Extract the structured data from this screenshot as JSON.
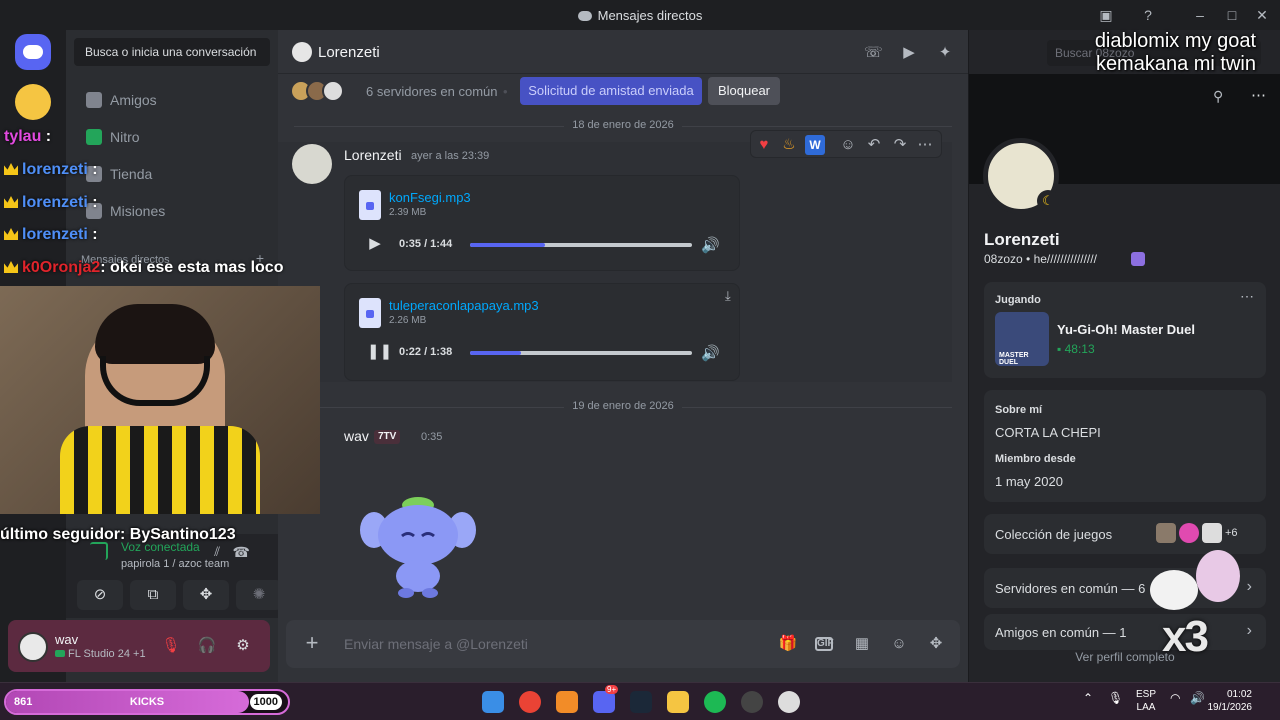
{
  "window": {
    "title": "Mensajes directos",
    "controls": [
      "inbox-icon",
      "help-icon",
      "minimize",
      "maximize",
      "close"
    ]
  },
  "sidebar": {
    "search_placeholder": "Busca o inicia una conversación",
    "nav": [
      {
        "label": "Amigos",
        "icon": "friends-icon"
      },
      {
        "label": "Nitro",
        "icon": "nitro-icon"
      },
      {
        "label": "Tienda",
        "icon": "shop-icon"
      },
      {
        "label": "Misiones",
        "icon": "quests-icon"
      }
    ],
    "dm_header": "Mensajes directos",
    "dm_item": "Lorenzeti"
  },
  "voice": {
    "status": "Voz conectada",
    "channel": "papirola 1 / azoc team"
  },
  "user": {
    "name": "wav",
    "activity": "FL Studio 24 +1"
  },
  "chat": {
    "recipient": "Lorenzeti",
    "mutual_servers": "6 servidores en común",
    "friend_request_sent": "Solicitud de amistad enviada",
    "block": "Bloquear",
    "dates": [
      "18 de enero de 2026",
      "19 de enero de 2026"
    ],
    "messages": [
      {
        "author": "Lorenzeti",
        "time": "ayer a las 23:39",
        "attachments": [
          {
            "name": "konFsegi.mp3",
            "size": "2.39 MB",
            "time": "0:35 / 1:44",
            "progress": 0.34,
            "state": "paused"
          },
          {
            "name": "tuleperaconlapapaya.mp3",
            "size": "2.26 MB",
            "time": "0:22 / 1:38",
            "progress": 0.23,
            "state": "playing"
          }
        ]
      },
      {
        "author": "wav",
        "badge": "7TV",
        "time": "0:35",
        "sticker": "wumpus-sticker"
      }
    ],
    "composer_placeholder": "Enviar mensaje a @Lorenzeti"
  },
  "profile": {
    "search_placeholder": "Buscar 08zozo",
    "display_name": "Lorenzeti",
    "username": "08zozo",
    "bio_status": "he///////////////",
    "playing_label": "Jugando",
    "game": "Yu-Gi-Oh! Master Duel",
    "game_art_text": "MASTER DUEL",
    "game_time": "48:13",
    "about_label": "Sobre mí",
    "about": "CORTA LA CHEPI",
    "member_since_label": "Miembro desde",
    "member_since": "1 may 2020",
    "games_collection": "Colección de juegos",
    "games_extra": "+6",
    "mutual_servers": "Servidores en común — 6",
    "mutual_friends": "Amigos en común — 1",
    "view_full": "Ver perfil completo"
  },
  "overlay": {
    "top_right_line1": "diablomix my goat",
    "top_right_line2": "kemakana mi twin",
    "chat_lines": [
      {
        "name": "tylau",
        "text": ":",
        "crown": false
      },
      {
        "name": "lorenzeti",
        "text": ":",
        "crown": true
      },
      {
        "name": "lorenzeti",
        "text": ":",
        "crown": true
      },
      {
        "name": "lorenzeti",
        "text": ":",
        "crown": true
      },
      {
        "name": "k0Oronja2",
        "text": ": okei ese esta mas loco",
        "crown": true
      }
    ],
    "follower": "último seguidor: BySantino123",
    "multiplier": "x3"
  },
  "taskbar": {
    "kicks_left": "861",
    "kicks_label": "KICKS",
    "kicks_right": "1000",
    "kicks_progress": 0.86,
    "discord_badge": "9+",
    "lang": "ESP",
    "lang_sub": "LAA",
    "time": "01:02",
    "date": "19/1/2026"
  }
}
